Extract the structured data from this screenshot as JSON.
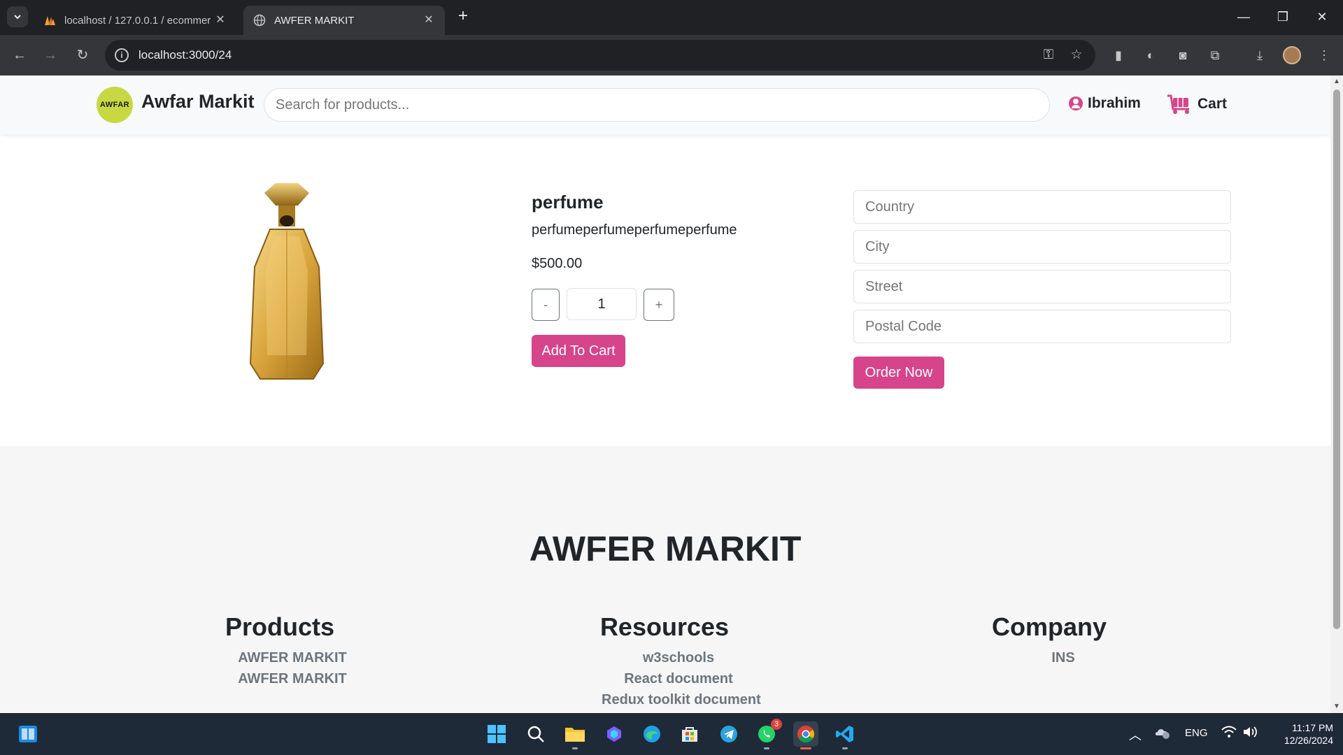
{
  "browser": {
    "tabs": [
      {
        "title": "localhost / 127.0.0.1 / ecommer",
        "active": false
      },
      {
        "title": "AWFER MARKIT",
        "active": true
      }
    ],
    "url": "localhost:3000/24"
  },
  "header": {
    "logo_text": "AWFAR",
    "brand": "Awfar Markit",
    "search_placeholder": "Search for products...",
    "user_name": "Ibrahim",
    "cart_label": "Cart",
    "accent_color": "#d6448b"
  },
  "product": {
    "name": "perfume",
    "description": "perfumeperfumeperfumeperfume",
    "price": "$500.00",
    "quantity": "1",
    "decrement_label": "-",
    "increment_label": "+",
    "add_to_cart_label": "Add To Cart"
  },
  "order_form": {
    "country_placeholder": "Country",
    "city_placeholder": "City",
    "street_placeholder": "Street",
    "postal_placeholder": "Postal Code",
    "order_label": "Order Now"
  },
  "footer": {
    "title": "AWFER MARKIT",
    "columns": [
      {
        "heading": "Products",
        "links": [
          "AWFER MARKIT",
          "AWFER MARKIT"
        ]
      },
      {
        "heading": "Resources",
        "links": [
          "w3schools",
          "React document",
          "Redux toolkit document"
        ]
      },
      {
        "heading": "Company",
        "links": [
          "INS"
        ]
      }
    ]
  },
  "taskbar": {
    "whatsapp_badge": "3",
    "language": "ENG",
    "time": "11:17 PM",
    "date": "12/26/2024"
  }
}
